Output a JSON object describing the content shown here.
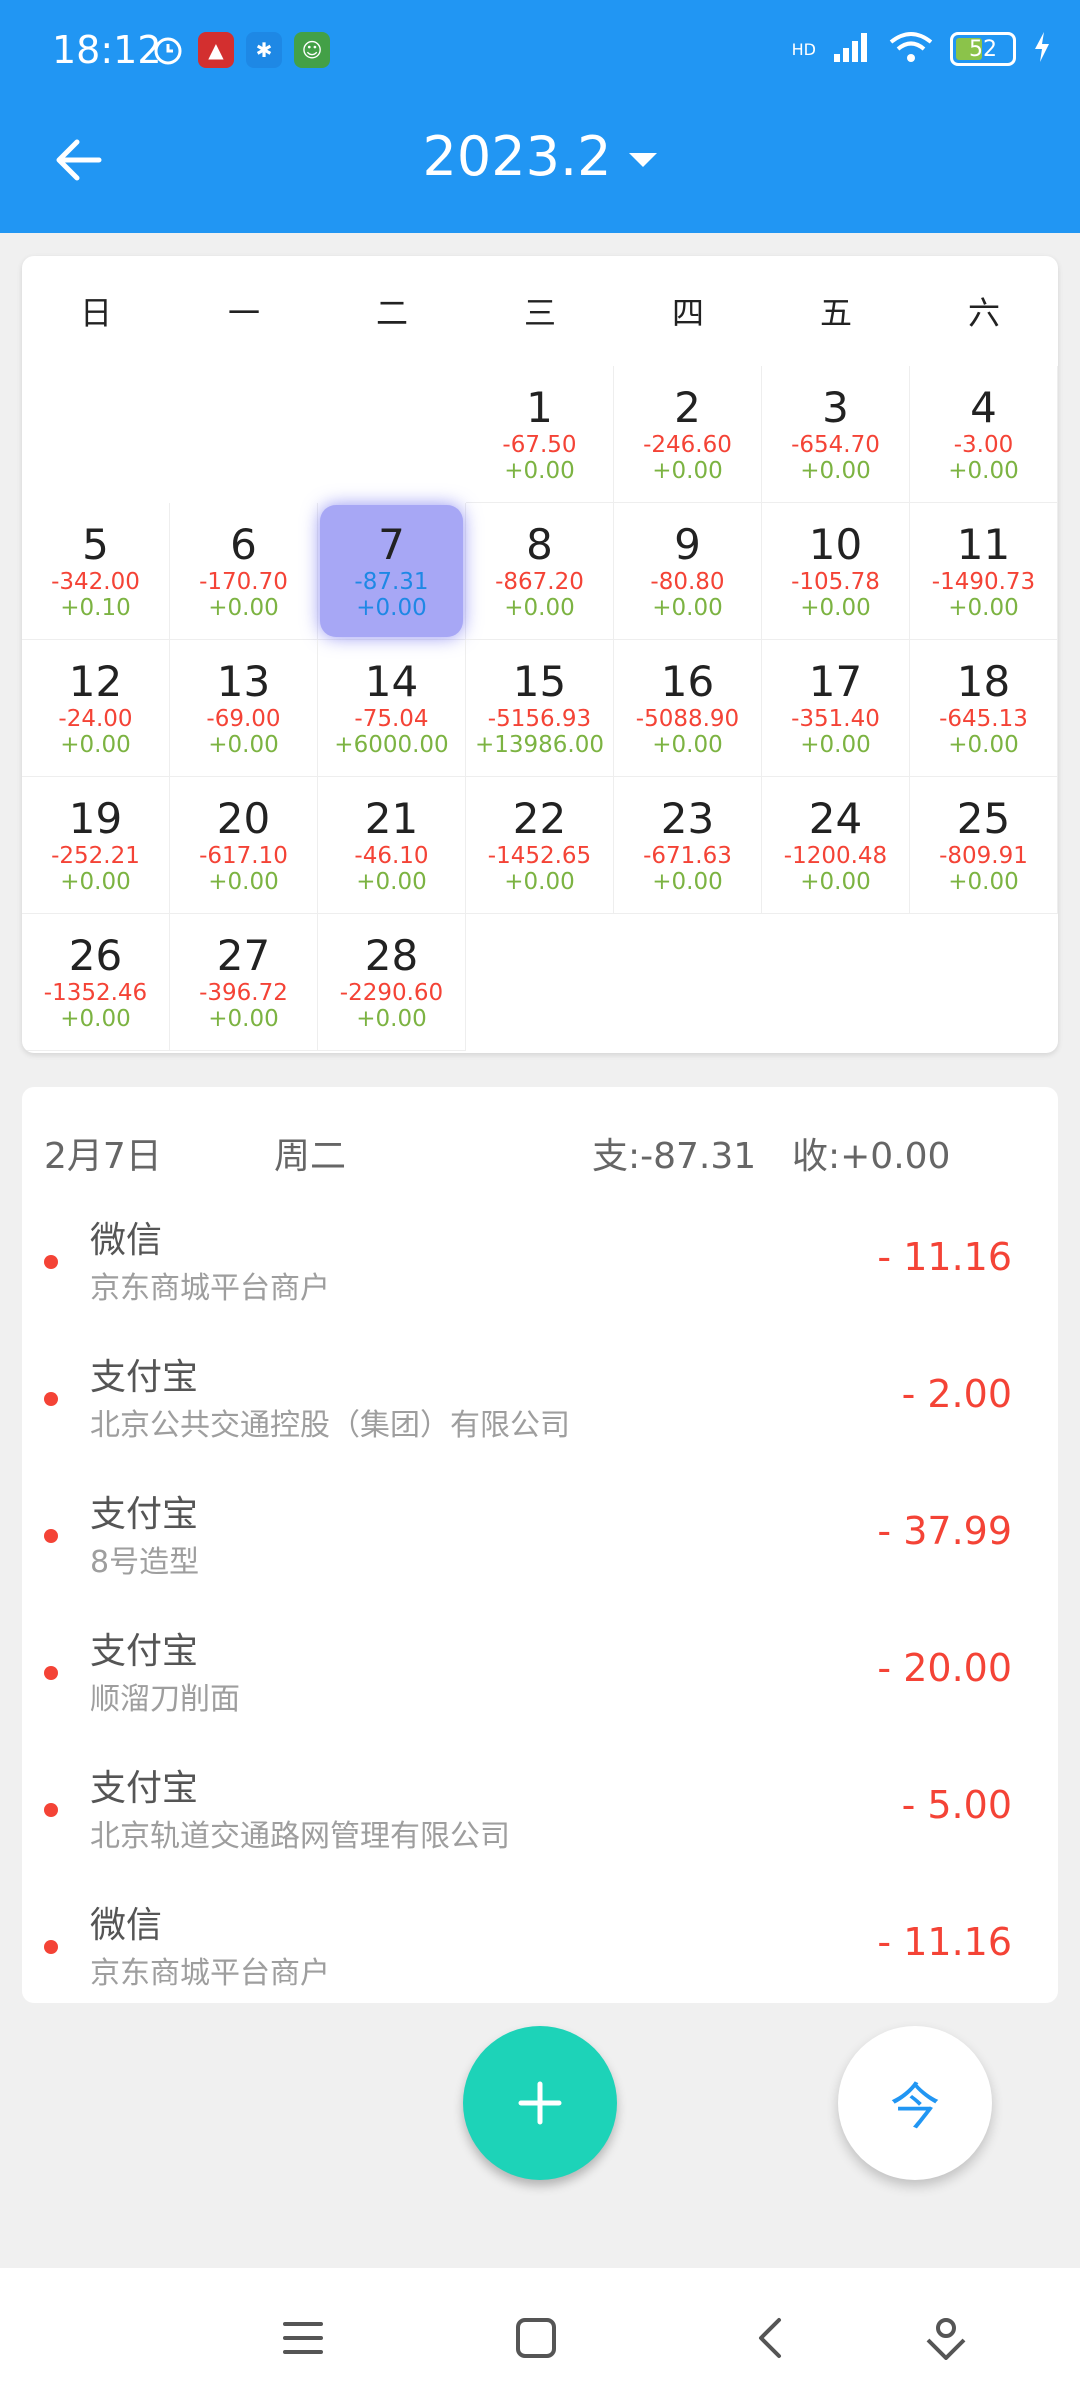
{
  "status": {
    "time": "18:12",
    "battery": "52",
    "network": "HD"
  },
  "header": {
    "title": "2023.2"
  },
  "calendar": {
    "weekdays": [
      "日",
      "一",
      "二",
      "三",
      "四",
      "五",
      "六"
    ],
    "days": [
      {
        "day": "1",
        "exp": "-67.50",
        "inc": "+0.00"
      },
      {
        "day": "2",
        "exp": "-246.60",
        "inc": "+0.00"
      },
      {
        "day": "3",
        "exp": "-654.70",
        "inc": "+0.00"
      },
      {
        "day": "4",
        "exp": "-3.00",
        "inc": "+0.00"
      },
      {
        "day": "5",
        "exp": "-342.00",
        "inc": "+0.10"
      },
      {
        "day": "6",
        "exp": "-170.70",
        "inc": "+0.00"
      },
      {
        "day": "7",
        "exp": "-87.31",
        "inc": "+0.00"
      },
      {
        "day": "8",
        "exp": "-867.20",
        "inc": "+0.00"
      },
      {
        "day": "9",
        "exp": "-80.80",
        "inc": "+0.00"
      },
      {
        "day": "10",
        "exp": "-105.78",
        "inc": "+0.00"
      },
      {
        "day": "11",
        "exp": "-1490.73",
        "inc": "+0.00"
      },
      {
        "day": "12",
        "exp": "-24.00",
        "inc": "+0.00"
      },
      {
        "day": "13",
        "exp": "-69.00",
        "inc": "+0.00"
      },
      {
        "day": "14",
        "exp": "-75.04",
        "inc": "+6000.00"
      },
      {
        "day": "15",
        "exp": "-5156.93",
        "inc": "+13986.00"
      },
      {
        "day": "16",
        "exp": "-5088.90",
        "inc": "+0.00"
      },
      {
        "day": "17",
        "exp": "-351.40",
        "inc": "+0.00"
      },
      {
        "day": "18",
        "exp": "-645.13",
        "inc": "+0.00"
      },
      {
        "day": "19",
        "exp": "-252.21",
        "inc": "+0.00"
      },
      {
        "day": "20",
        "exp": "-617.10",
        "inc": "+0.00"
      },
      {
        "day": "21",
        "exp": "-46.10",
        "inc": "+0.00"
      },
      {
        "day": "22",
        "exp": "-1452.65",
        "inc": "+0.00"
      },
      {
        "day": "23",
        "exp": "-671.63",
        "inc": "+0.00"
      },
      {
        "day": "24",
        "exp": "-1200.48",
        "inc": "+0.00"
      },
      {
        "day": "25",
        "exp": "-809.91",
        "inc": "+0.00"
      },
      {
        "day": "26",
        "exp": "-1352.46",
        "inc": "+0.00"
      },
      {
        "day": "27",
        "exp": "-396.72",
        "inc": "+0.00"
      },
      {
        "day": "28",
        "exp": "-2290.60",
        "inc": "+0.00"
      }
    ]
  },
  "detail": {
    "date": "2月7日",
    "weekday": "周二",
    "expense": "支:-87.31",
    "income": "收:+0.00",
    "transactions": [
      {
        "source": "微信",
        "merchant": "京东商城平台商户",
        "amount": "- 11.16"
      },
      {
        "source": "支付宝",
        "merchant": "北京公共交通控股（集团）有限公司",
        "amount": "- 2.00"
      },
      {
        "source": "支付宝",
        "merchant": "8号造型",
        "amount": "- 37.99"
      },
      {
        "source": "支付宝",
        "merchant": "顺溜刀削面",
        "amount": "- 20.00"
      },
      {
        "source": "支付宝",
        "merchant": "北京轨道交通路网管理有限公司",
        "amount": "- 5.00"
      },
      {
        "source": "微信",
        "merchant": "京东商城平台商户",
        "amount": "- 11.16"
      }
    ]
  },
  "fab": {
    "today_label": "今"
  },
  "colors": {
    "primary": "#2196f3",
    "expense": "#f44336",
    "income": "#7cb342",
    "selected": "#a7a7f5",
    "fab": "#1dd3b8"
  }
}
